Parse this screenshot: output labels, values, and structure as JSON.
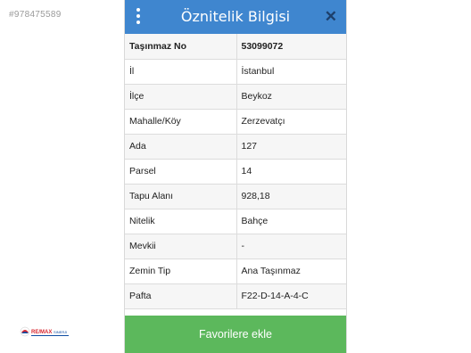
{
  "watermark": "#978475589",
  "logo": {
    "brand": "RE/MAX",
    "office": "SINERJI",
    "colors": {
      "red": "#d8262f",
      "blue": "#0f4da2"
    }
  },
  "panel": {
    "title": "Öznitelik Bilgisi",
    "icons": {
      "menu": "vertical-ellipsis-icon",
      "close": "close-icon"
    },
    "colors": {
      "header": "#3f86cf",
      "button": "#5cb85c"
    },
    "rows": [
      {
        "key": "Taşınmaz No",
        "value": "53099072"
      },
      {
        "key": "İl",
        "value": "İstanbul"
      },
      {
        "key": "İlçe",
        "value": "Beykoz"
      },
      {
        "key": "Mahalle/Köy",
        "value": "Zerzevatçı"
      },
      {
        "key": "Ada",
        "value": "127"
      },
      {
        "key": "Parsel",
        "value": "14"
      },
      {
        "key": "Tapu Alanı",
        "value": "928,18"
      },
      {
        "key": "Nitelik",
        "value": "Bahçe"
      },
      {
        "key": "Mevkii",
        "value": "-"
      },
      {
        "key": "Zemin Tip",
        "value": "Ana Taşınmaz"
      },
      {
        "key": "Pafta",
        "value": "F22-D-14-A-4-C"
      }
    ],
    "favorite_label": "Favorilere ekle"
  }
}
